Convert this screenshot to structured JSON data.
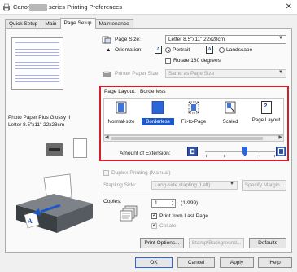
{
  "window": {
    "title_prefix": "Canon",
    "title_suffix": "series Printing Preferences",
    "close_symbol": "✕"
  },
  "tabs": [
    {
      "label": "Quick Setup",
      "active": false
    },
    {
      "label": "Main",
      "active": false
    },
    {
      "label": "Page Setup",
      "active": true
    },
    {
      "label": "Maintenance",
      "active": false
    }
  ],
  "preview": {
    "media_line1": "Photo Paper Plus Glossy II",
    "media_line2": "Letter 8.5\"x11\" 22x28cm"
  },
  "page_size": {
    "label": "Page Size:",
    "value": "Letter 8.5\"x11\" 22x28cm"
  },
  "orientation": {
    "label": "Orientation:",
    "portrait_label": "Portrait",
    "landscape_label": "Landscape",
    "selected": "Portrait",
    "rotate_label": "Rotate 180 degrees",
    "rotate_checked": false,
    "icon_letter": "A"
  },
  "printer_paper_size": {
    "label": "Printer Paper Size:",
    "value": "Same as Page Size"
  },
  "page_layout": {
    "label": "Page Layout:",
    "current": "Borderless",
    "options": [
      {
        "label": "Normal-size",
        "icon": "normal-size-icon",
        "selected": false
      },
      {
        "label": "Borderless",
        "icon": "borderless-icon",
        "selected": true
      },
      {
        "label": "Fit-to-Page",
        "icon": "fit-to-page-icon",
        "selected": false
      },
      {
        "label": "Scaled",
        "icon": "scaled-icon",
        "selected": false
      },
      {
        "label": "Page Layout",
        "icon": "page-layout-icon",
        "selected": false,
        "icon_text": "2"
      }
    ],
    "extension_label": "Amount of Extension:",
    "extension_level": 0.6
  },
  "duplex": {
    "label": "Duplex Printing (Manual)",
    "checked": false
  },
  "stapling": {
    "label": "Stapling Side:",
    "value": "Long-side stapling (Left)",
    "margin_button": "Specify Margin..."
  },
  "copies": {
    "label": "Copies:",
    "value": "1",
    "range": "(1-999)",
    "print_from_last_label": "Print from Last Page",
    "print_from_last_checked": true,
    "collate_label": "Collate",
    "collate_checked": true
  },
  "buttons": {
    "print_options": "Print Options...",
    "stamp_background": "Stamp/Background...",
    "defaults": "Defaults",
    "ok": "OK",
    "cancel": "Cancel",
    "apply": "Apply",
    "help": "Help"
  },
  "colors": {
    "highlight_border": "#d0202a",
    "selection": "#1c57c9",
    "slider_thumb": "#2b66d8"
  }
}
